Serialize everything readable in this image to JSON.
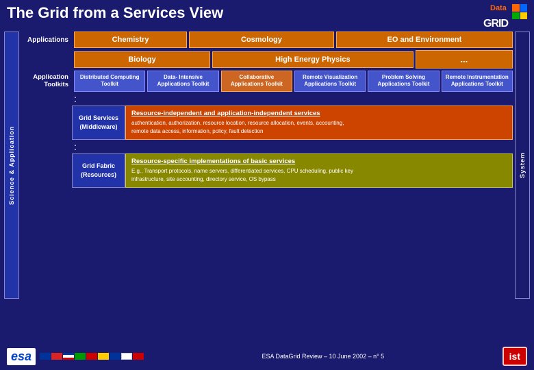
{
  "header": {
    "title": "The Grid from a Services View"
  },
  "logo": {
    "data_text": "Data",
    "grid_text": "GRID"
  },
  "applications": {
    "label": "Applications",
    "row1": [
      {
        "label": "Chemistry",
        "color": "#cc6600"
      },
      {
        "label": "Cosmology",
        "color": "#cc6600"
      },
      {
        "label": "EO and Environment",
        "color": "#cc6600"
      }
    ],
    "row2": [
      {
        "label": "Biology",
        "color": "#cc6600"
      },
      {
        "label": "High Energy Physics",
        "color": "#cc6600"
      },
      {
        "label": "...",
        "color": "#cc6600"
      }
    ]
  },
  "toolkits": {
    "label": "Application\nToolkits",
    "items": [
      {
        "label": "Distributed\nComputing\nToolkit"
      },
      {
        "label": "Data-\nIntensive\nApplications\nToolkit"
      },
      {
        "label": "Collaborative\nApplications\nToolkit"
      },
      {
        "label": "Remote\nVisualization\nApplications\nToolkit"
      },
      {
        "label": "Problem\nSolving\nApplications\nToolkit"
      },
      {
        "label": "Remote\nInstrumentation\nApplications\nToolkit"
      }
    ]
  },
  "grid_services": {
    "label": "Grid Services\n(Middleware)",
    "title": "Resource-independent and application-independent services",
    "text": "authentication, authorization, resource location, resource allocation, events, accounting,\nremote data access, information, policy, fault detection"
  },
  "grid_fabric": {
    "label": "Grid Fabric\n(Resources)",
    "title": "Resource-specific implementations of basic services",
    "text": "E.g., Transport protocols, name servers, differentiated services, CPU scheduling, public key\ninfrastructure, site accounting, directory service, OS bypass"
  },
  "axis_labels": {
    "science_application": "Science & Application",
    "system": "System"
  },
  "bottom": {
    "review_text": "ESA DataGrid Review –  10 June 2002 – n° 5"
  }
}
